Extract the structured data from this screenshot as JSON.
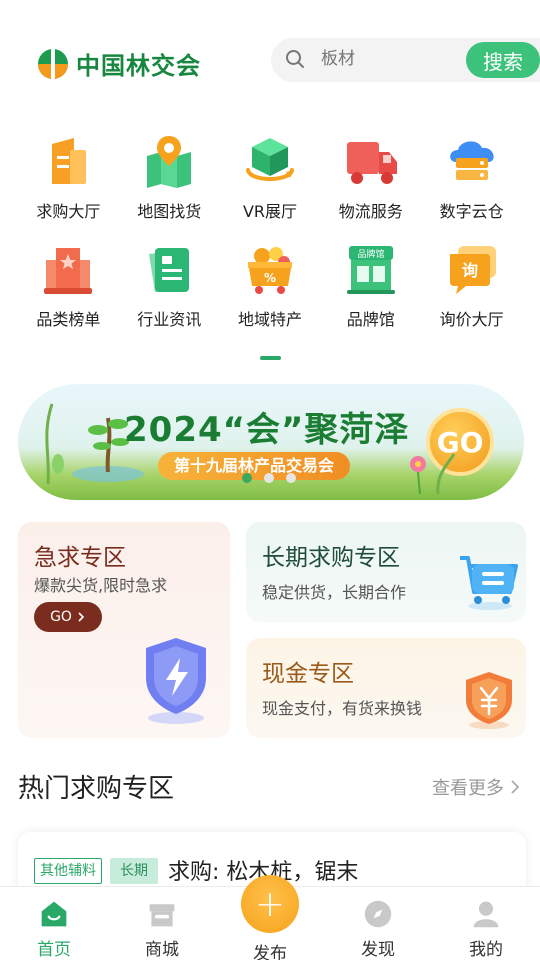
{
  "header": {
    "logo_text": "中国林交会",
    "search_placeholder": "板材",
    "search_button": "搜索"
  },
  "grid": [
    [
      {
        "label": "求购大厅",
        "icon": "buy-hall-icon"
      },
      {
        "label": "地图找货",
        "icon": "map-icon"
      },
      {
        "label": "VR展厅",
        "icon": "vr-icon"
      },
      {
        "label": "物流服务",
        "icon": "truck-icon"
      },
      {
        "label": "数字云仓",
        "icon": "cloud-warehouse-icon"
      }
    ],
    [
      {
        "label": "品类榜单",
        "icon": "ranking-icon"
      },
      {
        "label": "行业资讯",
        "icon": "news-icon"
      },
      {
        "label": "地域特产",
        "icon": "basket-icon"
      },
      {
        "label": "品牌馆",
        "icon": "brand-store-icon",
        "badge": "品牌馆"
      },
      {
        "label": "询价大厅",
        "icon": "inquiry-icon",
        "badge": "询"
      }
    ]
  ],
  "banner": {
    "title": "2024“会”聚菏泽",
    "subtitle": "第十九届林产品交易会",
    "go": "GO"
  },
  "zones": {
    "urgent": {
      "title": "急求专区",
      "desc": "爆款尖货,限时急求",
      "go": "GO"
    },
    "long_term": {
      "title": "长期求购专区",
      "desc": "稳定供货，长期合作"
    },
    "cash": {
      "title": "现金专区",
      "desc": "现金支付，有货来换钱"
    }
  },
  "section": {
    "title": "热门求购专区",
    "more": "查看更多"
  },
  "card": {
    "tag_category": "其他辅料",
    "tag_type": "长期",
    "title": "求购: 松木桩，锯末"
  },
  "tabbar": [
    {
      "label": "首页",
      "active": true
    },
    {
      "label": "商城",
      "active": false
    },
    {
      "label": "发布",
      "active": false
    },
    {
      "label": "发现",
      "active": false
    },
    {
      "label": "我的",
      "active": false
    }
  ],
  "colors": {
    "brand_green": "#2aa868",
    "accent_orange": "#f6a21c",
    "urgent_brown": "#7a2d1f"
  }
}
